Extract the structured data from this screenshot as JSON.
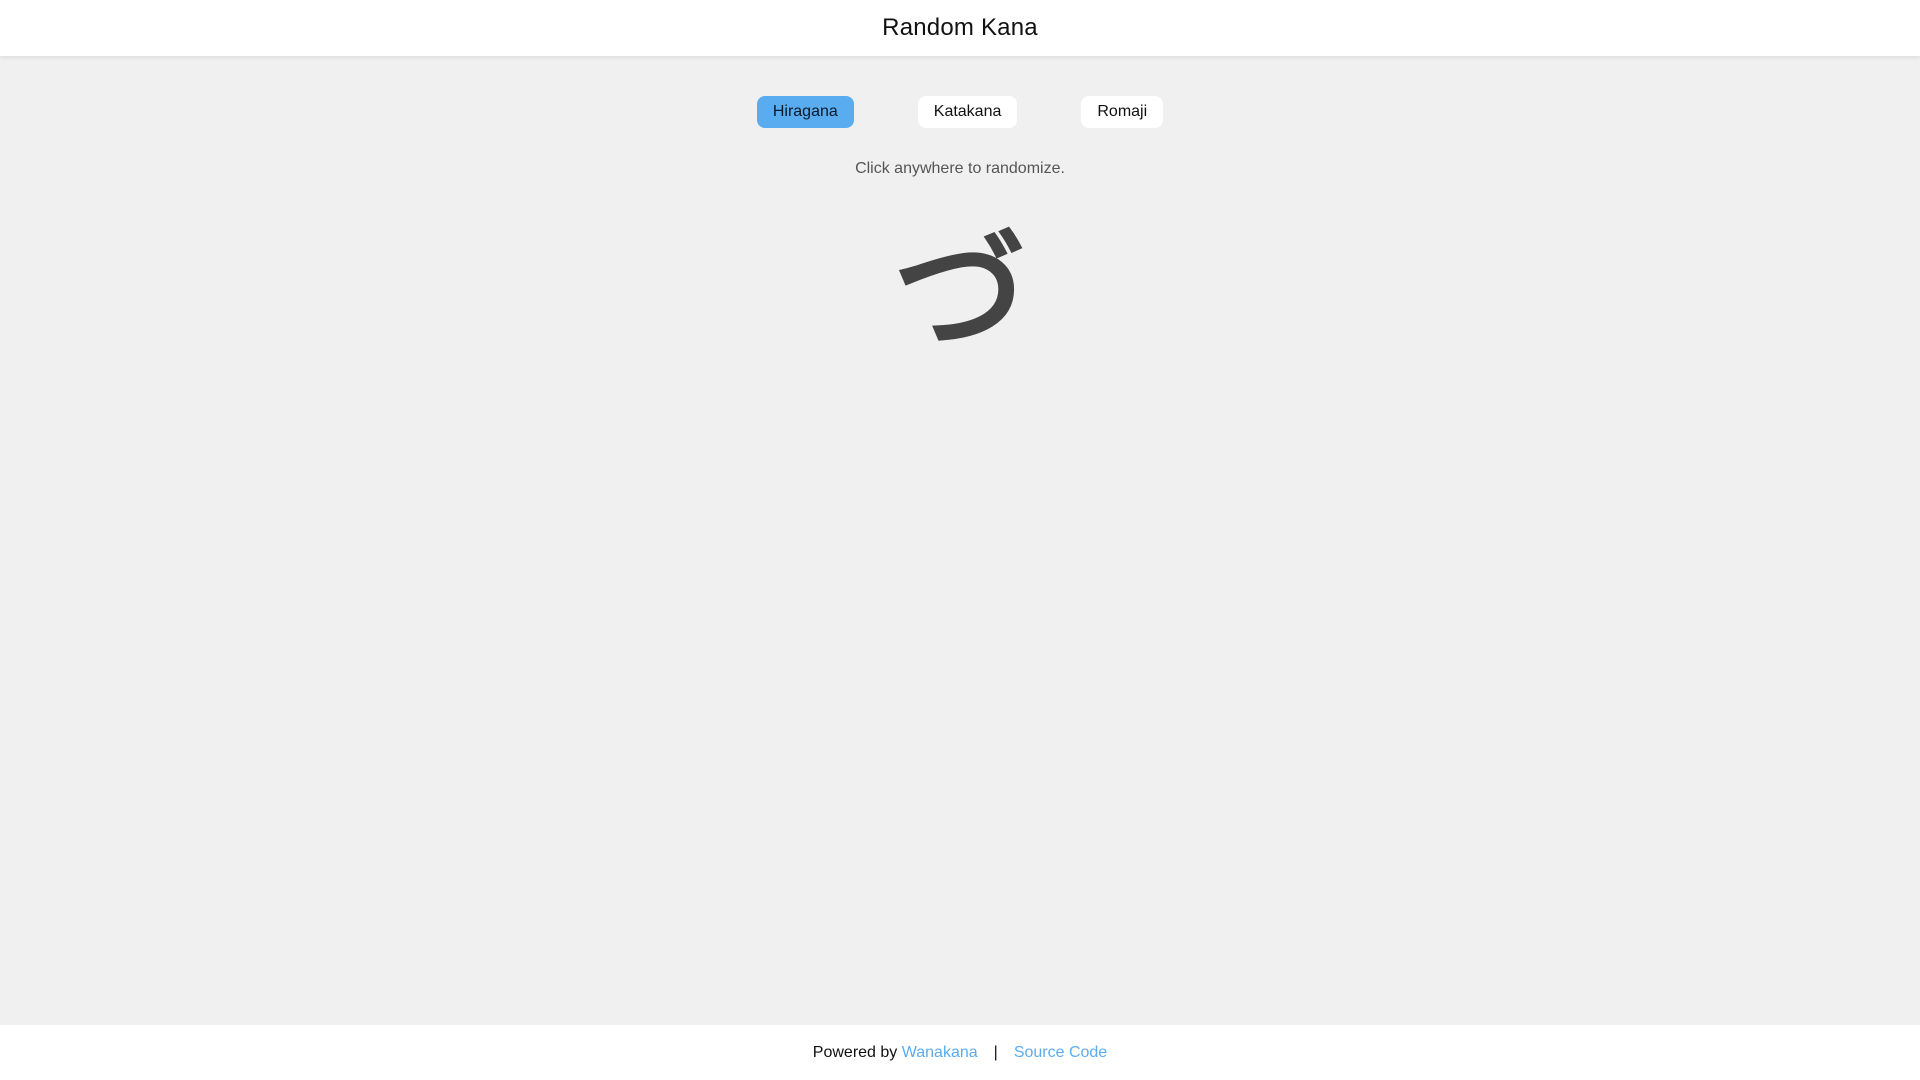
{
  "header": {
    "title": "Random Kana"
  },
  "modes": [
    {
      "label": "Hiragana",
      "active": true
    },
    {
      "label": "Katakana",
      "active": false
    },
    {
      "label": "Romaji",
      "active": false
    }
  ],
  "hint": "Click anywhere to randomize.",
  "kana": "づ",
  "footer": {
    "powered_prefix": "Powered by",
    "wanakana_link": "Wanakana",
    "separator": "|",
    "source_link": "Source Code"
  },
  "colors": {
    "accent": "#5aacf0",
    "background": "#f0f0f0",
    "kana": "#444444"
  }
}
